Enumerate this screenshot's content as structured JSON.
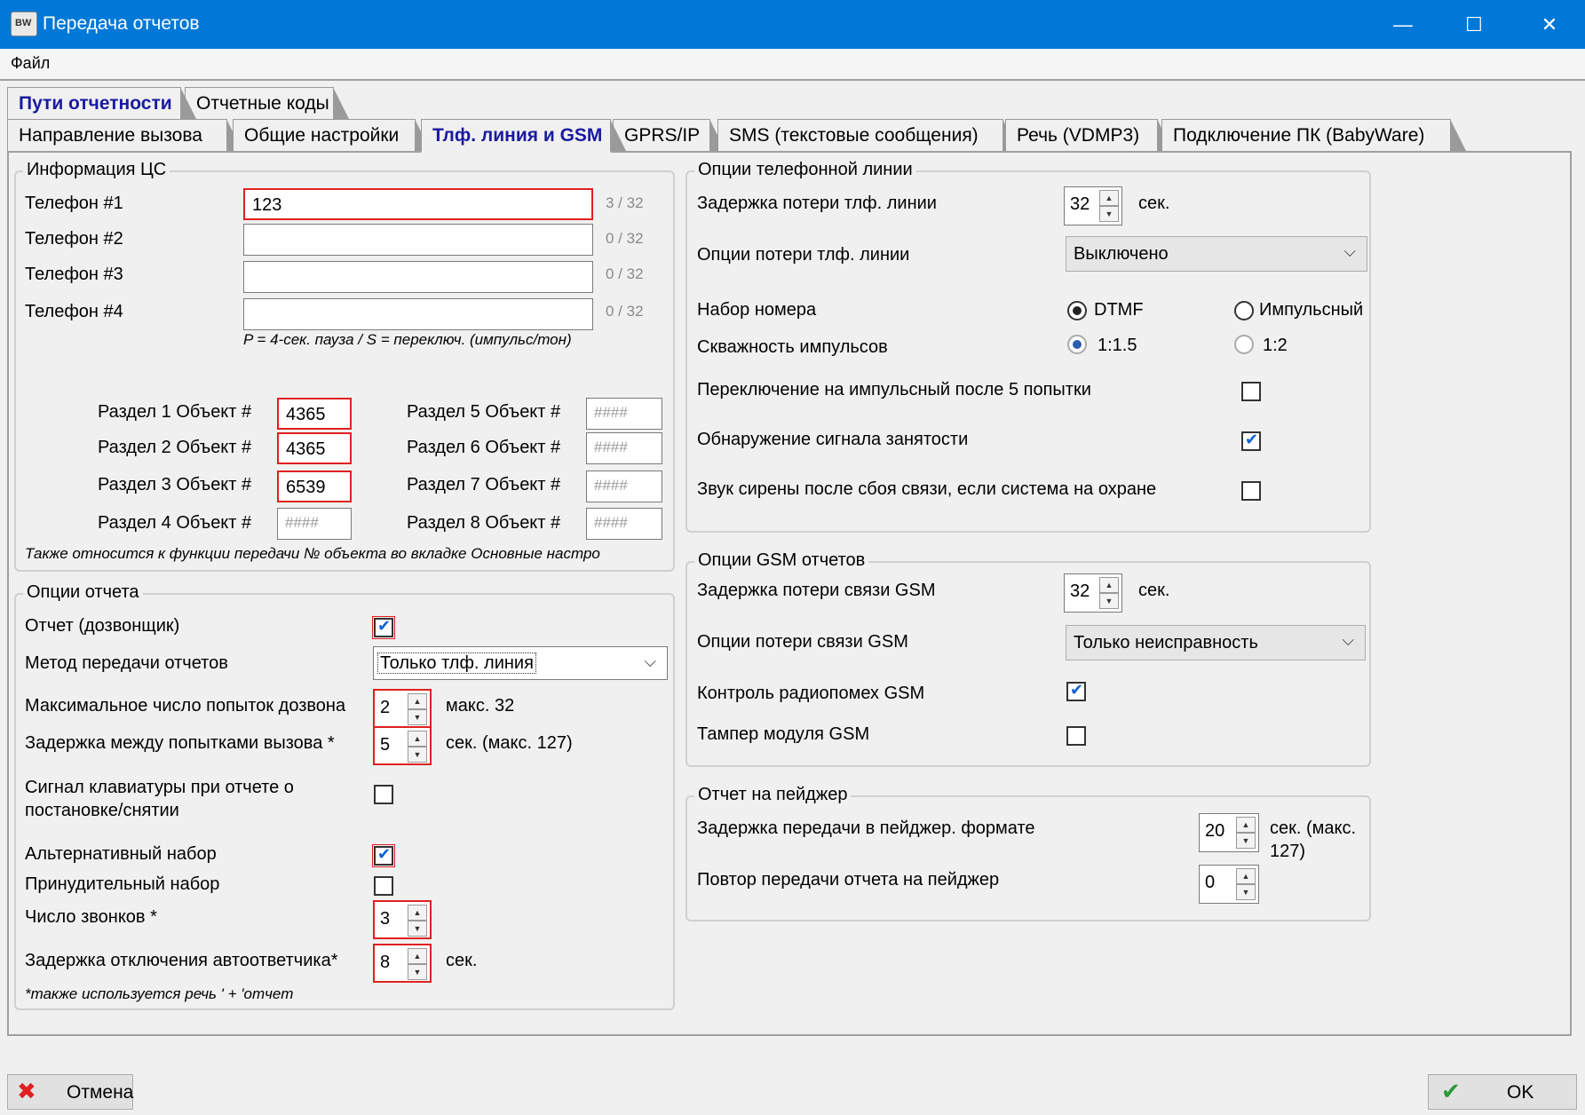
{
  "window": {
    "title": "Передача отчетов",
    "icon": "app-icon",
    "minimize": "—",
    "maximize": "☐",
    "close": "✕"
  },
  "menu": {
    "file": "Файл"
  },
  "tabs_row1": [
    "Пути отчетности",
    "Отчетные коды"
  ],
  "tabs_row2": [
    "Направление вызова",
    "Общие настройки",
    "Тлф. линия и GSM",
    "GPRS/IP",
    "SMS (текстовые сообщения)",
    "Речь (VDMP3)",
    "Подключение ПК (BabyWare)"
  ],
  "cs_info": {
    "title": "Информация ЦС",
    "phones": [
      {
        "label": "Телефон #1",
        "value": "123",
        "count": "3 / 32"
      },
      {
        "label": "Телефон #2",
        "value": "",
        "count": "0 / 32"
      },
      {
        "label": "Телефон #3",
        "value": "",
        "count": "0 / 32"
      },
      {
        "label": "Телефон #4",
        "value": "",
        "count": "0 / 32"
      }
    ],
    "phone_hint": "P = 4-сек. пауза / S = переключ. (импульс/тон)",
    "sections": [
      {
        "label": "Раздел 1 Объект #",
        "value": "4365"
      },
      {
        "label": "Раздел 2 Объект #",
        "value": "4365"
      },
      {
        "label": "Раздел 3 Объект #",
        "value": "6539"
      },
      {
        "label": "Раздел 4 Объект #",
        "value": "####"
      },
      {
        "label": "Раздел 5 Объект #",
        "value": "####"
      },
      {
        "label": "Раздел 6 Объект #",
        "value": "####"
      },
      {
        "label": "Раздел 7 Объект #",
        "value": "####"
      },
      {
        "label": "Раздел 8 Объект #",
        "value": "####"
      }
    ],
    "note": "Также относится к функции передачи № объекта во вкладке Основные настро"
  },
  "report_options": {
    "title": "Опции отчета",
    "dialer_label": "Отчет (дозвонщик)",
    "method_label": "Метод передачи отчетов",
    "method_value": "Только тлф. линия",
    "max_attempts_label": "Максимальное число попыток дозвона",
    "max_attempts_value": "2",
    "max_attempts_unit": "макс. 32",
    "delay_label": "Задержка между попытками вызова *",
    "delay_value": "5",
    "delay_unit": "сек. (макс. 127)",
    "keypad_label_1": "Сигнал клавиатуры при отчете о",
    "keypad_label_2": "постановке/снятии",
    "alt_dial_label": "Альтернативный набор",
    "forced_dial_label": "Принудительный набор",
    "rings_label": "Число звонков *",
    "rings_value": "3",
    "answering_label": "Задержка отключения автоответчика*",
    "answering_value": "8",
    "answering_unit": "сек.",
    "footnote": "*также используется речь ' + 'отчет"
  },
  "phone_line": {
    "title": "Опции телефонной линии",
    "loss_delay_label": "Задержка потери тлф. линии",
    "loss_delay_value": "32",
    "loss_delay_unit": "сек.",
    "loss_options_label": "Опции потери тлф. линии",
    "loss_options_value": "Выключено",
    "dialing_label": "Набор номера",
    "dtmf_label": "DTMF",
    "pulse_label": "Импульсный",
    "ratio_label": "Скважность импульсов",
    "ratio_a": "1:1.5",
    "ratio_b": "1:2",
    "switch_pulse_label": "Переключение на импульсный после 5 попытки",
    "busy_detect_label": "Обнаружение сигнала занятости",
    "siren_label": "Звук сирены после сбоя связи, если система на охране"
  },
  "gsm": {
    "title": "Опции GSM отчетов",
    "loss_delay_label": "Задержка потери связи GSM",
    "loss_delay_value": "32",
    "loss_delay_unit": "сек.",
    "loss_options_label": "Опции потери связи GSM",
    "loss_options_value": "Только неисправность",
    "jam_label": "Контроль радиопомех GSM",
    "tamper_label": "Тампер модуля GSM"
  },
  "pager": {
    "title": "Отчет на пейджер",
    "delay_label": "Задержка передачи в пейджер. формате",
    "delay_value": "20",
    "delay_unit_1": "сек. (макс.",
    "delay_unit_2": "127)",
    "repeat_label": "Повтор передачи отчета на пейджер",
    "repeat_value": "0"
  },
  "buttons": {
    "cancel": "Отмена",
    "ok": "OK",
    "cancel_icon": "cross-icon",
    "ok_icon": "checkmark-icon"
  },
  "colors": {
    "titlebar": "#0078d7",
    "required_border": "#e02020",
    "check": "#1060d0",
    "active_tab_text": "#1a1aa0"
  }
}
